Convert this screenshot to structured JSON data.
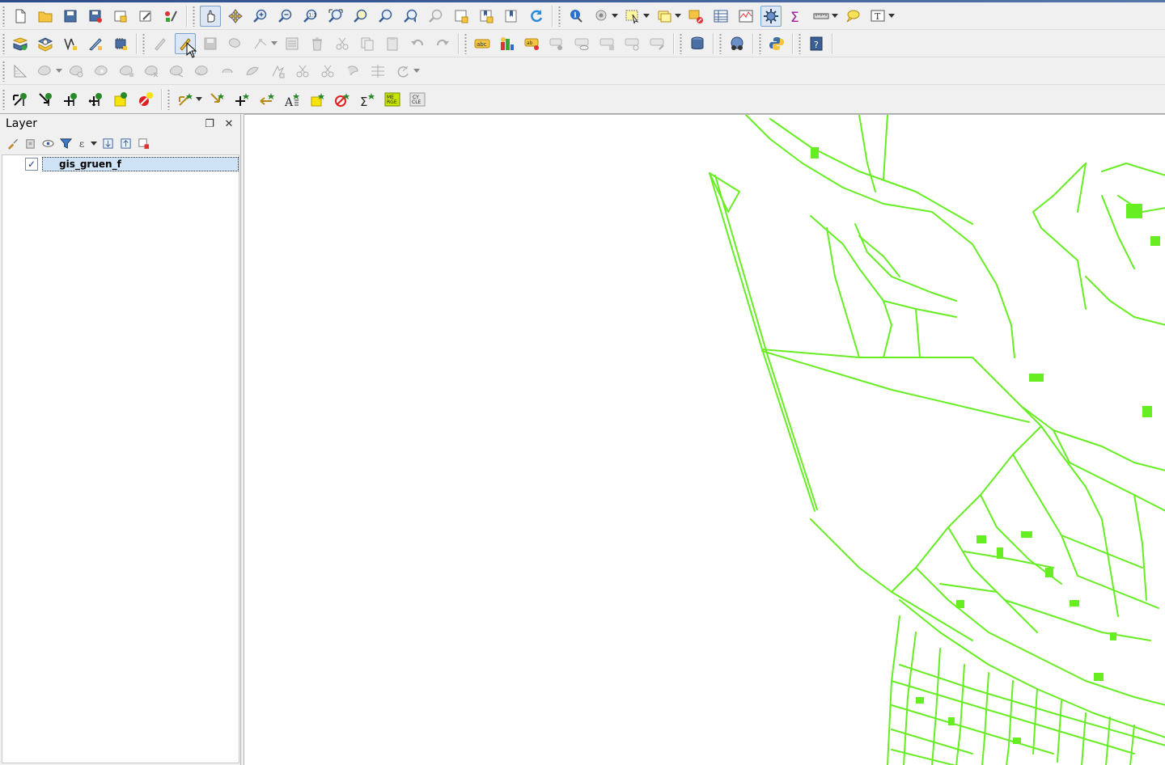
{
  "colors": {
    "accent": "#7ea1cc",
    "map_feature": "#66ee22",
    "map_background": "#ffffff",
    "selection": "#cfe3f7"
  },
  "toolbars": {
    "row1": [
      {
        "icon": "new-project-icon"
      },
      {
        "icon": "open-project-icon"
      },
      {
        "icon": "save-project-icon"
      },
      {
        "icon": "save-as-icon"
      },
      {
        "icon": "new-print-composer-icon"
      },
      {
        "icon": "composer-manager-icon"
      },
      {
        "icon": "style-manager-icon"
      },
      {
        "icon": "pan-icon",
        "active": true
      },
      {
        "icon": "pan-to-selection-icon"
      },
      {
        "icon": "zoom-in-icon"
      },
      {
        "icon": "zoom-out-icon"
      },
      {
        "icon": "zoom-native-icon"
      },
      {
        "icon": "zoom-full-icon"
      },
      {
        "icon": "zoom-to-selection-icon"
      },
      {
        "icon": "zoom-to-layer-icon"
      },
      {
        "icon": "zoom-last-icon"
      },
      {
        "icon": "zoom-next-icon"
      },
      {
        "icon": "new-map-view-icon"
      },
      {
        "icon": "new-bookmark-icon"
      },
      {
        "icon": "show-bookmarks-icon"
      },
      {
        "icon": "refresh-icon"
      },
      {
        "icon": "identify-icon"
      },
      {
        "icon": "action-icon"
      },
      {
        "icon": "select-features-icon"
      },
      {
        "icon": "select-by-expression-icon"
      },
      {
        "icon": "deselect-icon"
      },
      {
        "icon": "attribute-table-icon"
      },
      {
        "icon": "field-calculator-icon"
      },
      {
        "icon": "statistics-icon",
        "active": true
      },
      {
        "icon": "sum-icon"
      },
      {
        "icon": "measure-icon"
      },
      {
        "icon": "map-tips-icon"
      },
      {
        "icon": "text-annotation-icon"
      }
    ],
    "row2": [
      {
        "icon": "add-vector-layer-icon"
      },
      {
        "icon": "add-raster-layer-icon"
      },
      {
        "icon": "new-shapefile-icon"
      },
      {
        "icon": "digitize-icon"
      },
      {
        "icon": "new-memory-layer-icon"
      },
      {
        "icon": "current-edits-icon"
      },
      {
        "icon": "toggle-editing-icon",
        "active": true
      },
      {
        "icon": "save-edits-icon"
      },
      {
        "icon": "add-feature-icon"
      },
      {
        "icon": "node-tool-icon"
      },
      {
        "icon": "move-feature-icon"
      },
      {
        "icon": "delete-selected-icon"
      },
      {
        "icon": "cut-features-icon"
      },
      {
        "icon": "copy-features-icon"
      },
      {
        "icon": "paste-features-icon"
      },
      {
        "icon": "undo-icon"
      },
      {
        "icon": "redo-icon"
      },
      {
        "icon": "label-icon"
      },
      {
        "icon": "diagram-icon"
      },
      {
        "icon": "pin-labels-icon"
      },
      {
        "icon": "show-hide-labels-icon"
      },
      {
        "icon": "move-label-icon"
      },
      {
        "icon": "rotate-label-icon"
      },
      {
        "icon": "change-label-icon"
      },
      {
        "icon": "label-properties-icon"
      },
      {
        "icon": "database-icon"
      },
      {
        "icon": "grass-icon"
      },
      {
        "icon": "python-console-icon"
      },
      {
        "icon": "help-icon"
      }
    ],
    "row3": [
      {
        "icon": "draw-shape-icon"
      },
      {
        "icon": "add-ring-icon"
      },
      {
        "icon": "add-part-icon"
      },
      {
        "icon": "fill-ring-icon"
      },
      {
        "icon": "delete-ring-icon"
      },
      {
        "icon": "delete-part-icon"
      },
      {
        "icon": "reshape-features-icon"
      },
      {
        "icon": "offset-curve-icon"
      },
      {
        "icon": "split-features-icon"
      },
      {
        "icon": "split-parts-icon"
      },
      {
        "icon": "merge-selected-icon"
      },
      {
        "icon": "merge-attributes-icon"
      },
      {
        "icon": "rotate-point-symbols-icon"
      },
      {
        "icon": "simplify-icon"
      },
      {
        "icon": "rotate-feature-icon"
      }
    ],
    "row4": [
      {
        "icon": "tree-arrow-ne-icon"
      },
      {
        "icon": "tree-arrow-se-icon"
      },
      {
        "icon": "tree-cross-icon"
      },
      {
        "icon": "tree-move-icon"
      },
      {
        "icon": "yellow-square-icon"
      },
      {
        "icon": "delete-red-icon"
      },
      {
        "icon": "star-arrow-icon"
      },
      {
        "icon": "star-arrow-down-icon"
      },
      {
        "icon": "star-cross-icon"
      },
      {
        "icon": "arrow-left-icon"
      },
      {
        "icon": "text-a-icon"
      },
      {
        "icon": "yellow-star-icon"
      },
      {
        "icon": "red-arrow-icon"
      },
      {
        "icon": "sigma-star-icon"
      }
    ],
    "merge_label": "ME\nRGE",
    "cycle_label": "CY\nCLE"
  },
  "layer_panel": {
    "title": "Layer",
    "layers": [
      {
        "name": "gis_gruen_f",
        "checked": true
      }
    ]
  }
}
